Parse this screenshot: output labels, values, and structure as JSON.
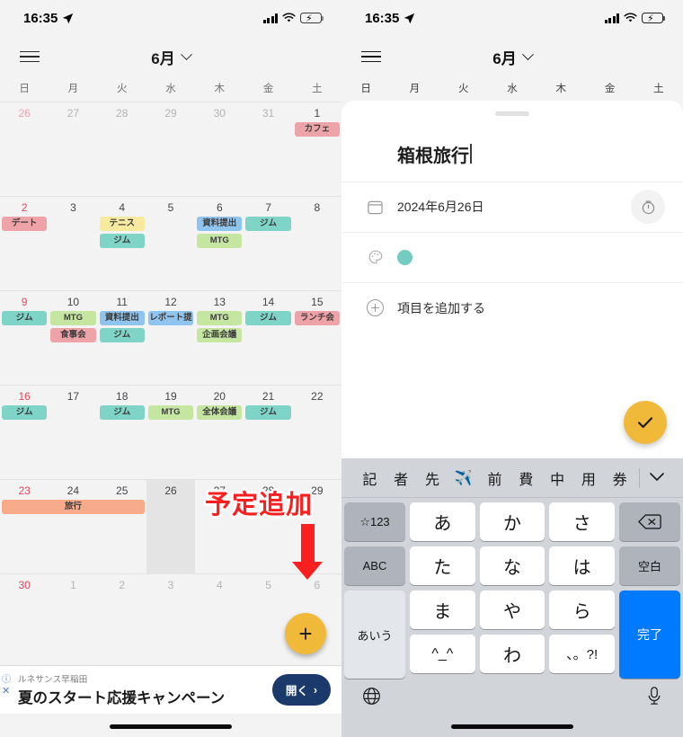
{
  "statusbar": {
    "time": "16:35",
    "location_icon": "location-arrow-icon",
    "wifi_icon": "wifi-icon",
    "battery_icon": "battery-charging-icon"
  },
  "calendar": {
    "menu_icon": "hamburger-menu-icon",
    "month_label": "6月",
    "chevron_icon": "chevron-down-icon",
    "weekdays": [
      "日",
      "月",
      "火",
      "水",
      "木",
      "金",
      "土"
    ],
    "weeks": [
      {
        "days": [
          {
            "num": "26",
            "dim": true,
            "sun": true,
            "chips": []
          },
          {
            "num": "27",
            "dim": true,
            "chips": []
          },
          {
            "num": "28",
            "dim": true,
            "chips": []
          },
          {
            "num": "29",
            "dim": true,
            "chips": []
          },
          {
            "num": "30",
            "dim": true,
            "chips": []
          },
          {
            "num": "31",
            "dim": true,
            "chips": []
          },
          {
            "num": "1",
            "chips": [
              {
                "label": "カフェ",
                "color": "#eda3a8"
              }
            ]
          }
        ]
      },
      {
        "days": [
          {
            "num": "2",
            "sun": true,
            "chips": [
              {
                "label": "デート",
                "color": "#eda3a8"
              }
            ]
          },
          {
            "num": "3",
            "chips": []
          },
          {
            "num": "4",
            "chips": [
              {
                "label": "テニス",
                "color": "#f7ea9e"
              },
              {
                "label": "ジム",
                "color": "#7fd4c8"
              }
            ]
          },
          {
            "num": "5",
            "chips": []
          },
          {
            "num": "6",
            "chips": [
              {
                "label": "資料提出",
                "color": "#8fc4ee"
              },
              {
                "label": "MTG",
                "color": "#c5e6a0"
              }
            ]
          },
          {
            "num": "7",
            "chips": [
              {
                "label": "ジム",
                "color": "#7fd4c8"
              }
            ]
          },
          {
            "num": "8",
            "chips": []
          }
        ]
      },
      {
        "days": [
          {
            "num": "9",
            "sun": true,
            "chips": [
              {
                "label": "ジム",
                "color": "#7fd4c8"
              }
            ]
          },
          {
            "num": "10",
            "chips": [
              {
                "label": "MTG",
                "color": "#c5e6a0"
              },
              {
                "label": "食事会",
                "color": "#eda3a8"
              }
            ]
          },
          {
            "num": "11",
            "chips": [
              {
                "label": "資料提出",
                "color": "#8fc4ee"
              },
              {
                "label": "ジム",
                "color": "#7fd4c8"
              }
            ]
          },
          {
            "num": "12",
            "chips": [
              {
                "label": "レポート提",
                "color": "#8fc4ee"
              }
            ]
          },
          {
            "num": "13",
            "chips": [
              {
                "label": "MTG",
                "color": "#c5e6a0"
              },
              {
                "label": "企画会議",
                "color": "#c5e6a0"
              }
            ]
          },
          {
            "num": "14",
            "chips": [
              {
                "label": "ジム",
                "color": "#7fd4c8"
              }
            ]
          },
          {
            "num": "15",
            "chips": [
              {
                "label": "ランチ会",
                "color": "#eda3a8"
              }
            ]
          }
        ]
      },
      {
        "days": [
          {
            "num": "16",
            "sun": true,
            "chips": [
              {
                "label": "ジム",
                "color": "#7fd4c8"
              }
            ]
          },
          {
            "num": "17",
            "chips": []
          },
          {
            "num": "18",
            "chips": [
              {
                "label": "ジム",
                "color": "#7fd4c8"
              }
            ]
          },
          {
            "num": "19",
            "chips": [
              {
                "label": "MTG",
                "color": "#c5e6a0"
              }
            ]
          },
          {
            "num": "20",
            "chips": [
              {
                "label": "全体会議",
                "color": "#c5e6a0"
              }
            ]
          },
          {
            "num": "21",
            "chips": [
              {
                "label": "ジム",
                "color": "#7fd4c8"
              }
            ]
          },
          {
            "num": "22",
            "chips": []
          }
        ]
      },
      {
        "days": [
          {
            "num": "23",
            "sun": true,
            "chips": []
          },
          {
            "num": "24",
            "chips": []
          },
          {
            "num": "25",
            "chips": []
          },
          {
            "num": "26",
            "selected": true,
            "chips": []
          },
          {
            "num": "27",
            "chips": []
          },
          {
            "num": "28",
            "chips": []
          },
          {
            "num": "29",
            "chips": []
          }
        ],
        "span": {
          "label": "旅行",
          "color": "#f7ab8a",
          "start": 0,
          "end": 2
        }
      },
      {
        "days": [
          {
            "num": "30",
            "sun": true,
            "chips": []
          },
          {
            "num": "1",
            "dim": true,
            "chips": []
          },
          {
            "num": "2",
            "dim": true,
            "chips": []
          },
          {
            "num": "3",
            "dim": true,
            "chips": []
          },
          {
            "num": "4",
            "dim": true,
            "chips": []
          },
          {
            "num": "5",
            "dim": true,
            "chips": []
          },
          {
            "num": "6",
            "dim": true,
            "chips": []
          }
        ]
      }
    ],
    "fab_add_label": "+",
    "fab_add_icon": "plus-icon"
  },
  "annotation": {
    "text": "予定追加",
    "arrow_icon": "down-arrow-icon",
    "color": "#fc1f1f"
  },
  "ad": {
    "advertiser": "ルネサンス早稲田",
    "title": "夏のスタート応援キャンペーン",
    "button_label": "開く",
    "button_chevron": "›",
    "info_icon": "info-icon",
    "close_icon": "close-icon"
  },
  "sheet": {
    "grab_handle": "drag-handle",
    "title": "箱根旅行",
    "date_icon": "calendar-icon",
    "date_value": "2024年6月26日",
    "timer_icon": "timer-icon",
    "palette_icon": "palette-icon",
    "color_value": "#74ccc0",
    "add_item_icon": "plus-circle-icon",
    "add_item_label": "項目を追加する",
    "done_icon": "check-icon"
  },
  "keyboard": {
    "suggestions": [
      "記",
      "者",
      "先",
      "✈️",
      "前",
      "費",
      "中",
      "用",
      "券"
    ],
    "collapse_icon": "chevron-down-icon",
    "key_num": "☆123",
    "key_abc": "ABC",
    "key_kana": "あいう",
    "key_delete_icon": "backspace-icon",
    "key_space": "空白",
    "key_done": "完了",
    "rows": [
      [
        "あ",
        "か",
        "さ"
      ],
      [
        "た",
        "な",
        "は"
      ],
      [
        "ま",
        "や",
        "ら"
      ],
      [
        "^_^",
        "わ",
        "、。?!"
      ]
    ],
    "globe_icon": "globe-icon",
    "mic_icon": "microphone-icon"
  }
}
